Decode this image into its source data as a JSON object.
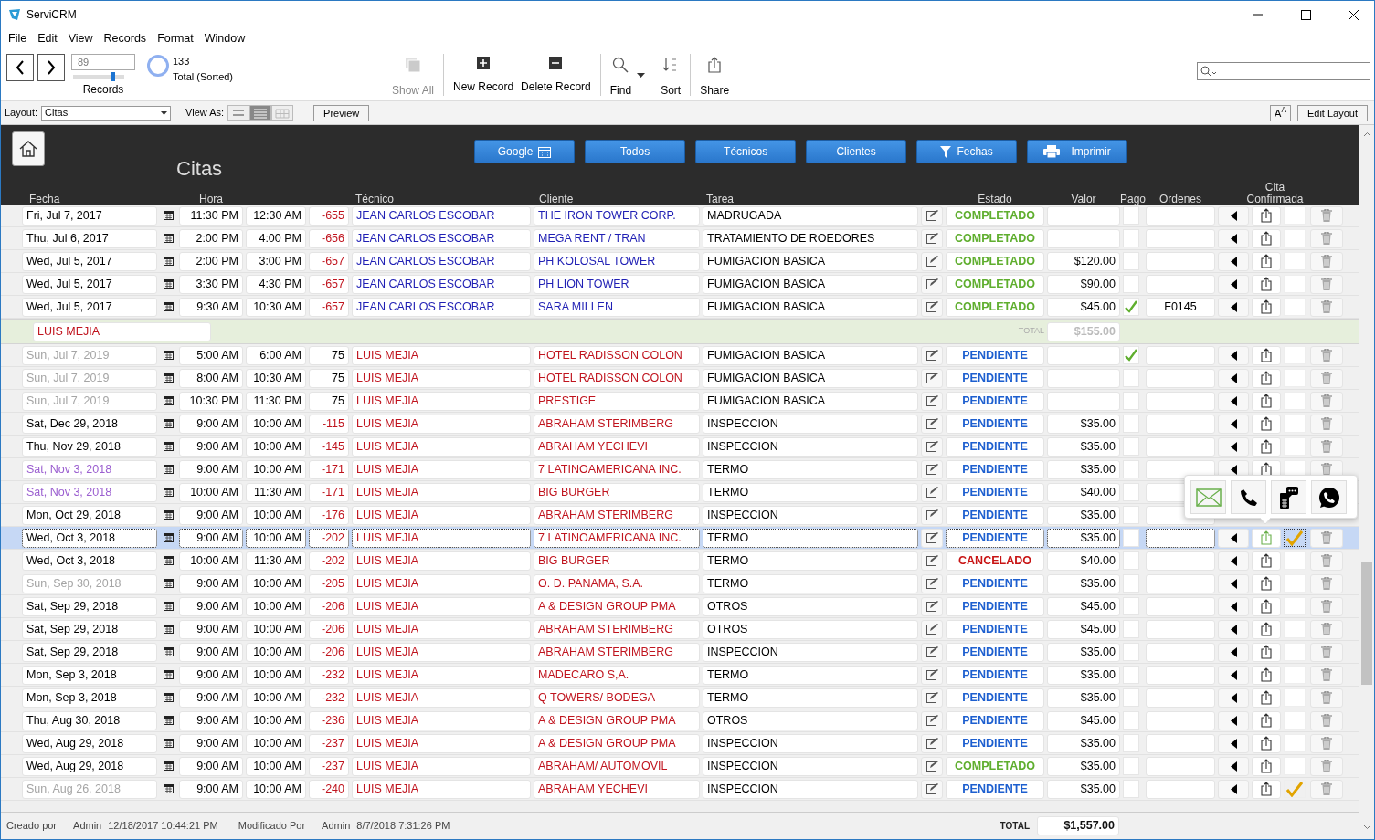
{
  "window": {
    "title": "ServiCRM"
  },
  "menu": [
    "File",
    "Edit",
    "View",
    "Records",
    "Format",
    "Window"
  ],
  "toolbar": {
    "record": "89",
    "slider": {
      "level": 0.78
    },
    "records_label": "Records",
    "total": "133",
    "total_label": "Total (Sorted)",
    "buttons": [
      {
        "label": "Show All",
        "kind": "show_all",
        "disabled": true
      },
      {
        "label": "New Record",
        "kind": "new",
        "disabled": false
      },
      {
        "label": "Delete Record",
        "kind": "delete",
        "disabled": false
      },
      {
        "label": "Find",
        "kind": "find",
        "disabled": false
      },
      {
        "label": "Sort",
        "kind": "sort",
        "disabled": false
      },
      {
        "label": "Share",
        "kind": "share",
        "disabled": false
      }
    ]
  },
  "layout_bar": {
    "layout_label": "Layout:",
    "layout": "Citas",
    "view_label": "View As:",
    "views": [
      {
        "kind": "form",
        "selected": false
      },
      {
        "kind": "list",
        "selected": true
      },
      {
        "kind": "table",
        "selected": false
      }
    ],
    "preview": "Preview",
    "font_button": "A$^{A}$",
    "edit_layout": "Edit Layout"
  },
  "header": {
    "title": "Citas",
    "buttons": [
      {
        "label": "Google"
      },
      {
        "label": "Todos"
      },
      {
        "label": "Técnicos"
      },
      {
        "label": "Clientes"
      },
      {
        "label": "Fechas"
      },
      {
        "label": "Imprimir"
      }
    ],
    "columns": [
      "Fecha",
      "Hora",
      "Técnico",
      "Cliente",
      "Tarea",
      "Estado",
      "Valor",
      "Pago",
      "Ordenes",
      "Cita Confirmada"
    ]
  },
  "rows": [
    {
      "kind": "record",
      "date": {
        "text": "Fri, Jul 7, 2017",
        "color": "#000000"
      },
      "start": "11:30 PM",
      "end": "12:30 AM",
      "number": "-655",
      "late": true,
      "technician": "JEAN CARLOS ESCOBAR",
      "client": "THE IRON TOWER CORP.",
      "color": "#1f1fb4",
      "task": "MADRUGADA",
      "status": {
        "text": "COMPLETADO",
        "color": "#5fae2e"
      },
      "value": "",
      "paid": false,
      "order": "",
      "confirmed": false,
      "selected": false
    },
    {
      "kind": "record",
      "date": {
        "text": "Thu, Jul 6, 2017",
        "color": "#000000"
      },
      "start": "2:00 PM",
      "end": "4:00 PM",
      "number": "-656",
      "late": true,
      "technician": "JEAN CARLOS ESCOBAR",
      "client": "MEGA RENT / TRAN",
      "color": "#1f1fb4",
      "task": "TRATAMIENTO DE ROEDORES",
      "status": {
        "text": "COMPLETADO",
        "color": "#5fae2e"
      },
      "value": "",
      "paid": false,
      "order": "",
      "confirmed": false,
      "selected": false
    },
    {
      "kind": "record",
      "date": {
        "text": "Wed, Jul 5, 2017",
        "color": "#000000"
      },
      "start": "2:00 PM",
      "end": "3:00 PM",
      "number": "-657",
      "late": true,
      "technician": "JEAN CARLOS ESCOBAR",
      "client": "PH KOLOSAL TOWER",
      "color": "#1f1fb4",
      "task": "FUMIGACION BASICA",
      "status": {
        "text": "COMPLETADO",
        "color": "#5fae2e"
      },
      "value": "$120.00",
      "paid": false,
      "order": "",
      "confirmed": false,
      "selected": false
    },
    {
      "kind": "record",
      "date": {
        "text": "Wed, Jul 5, 2017",
        "color": "#000000"
      },
      "start": "3:30 PM",
      "end": "4:30 PM",
      "number": "-657",
      "late": true,
      "technician": "JEAN CARLOS ESCOBAR",
      "client": "PH LION TOWER",
      "color": "#1f1fb4",
      "task": "FUMIGACION BASICA",
      "status": {
        "text": "COMPLETADO",
        "color": "#5fae2e"
      },
      "value": "$90.00",
      "paid": false,
      "order": "",
      "confirmed": false,
      "selected": false
    },
    {
      "kind": "record",
      "date": {
        "text": "Wed, Jul 5, 2017",
        "color": "#000000"
      },
      "start": "9:30 AM",
      "end": "10:30 AM",
      "number": "-657",
      "late": true,
      "technician": "JEAN CARLOS ESCOBAR",
      "client": "SARA MILLEN",
      "color": "#1f1fb4",
      "task": "FUMIGACION BASICA",
      "status": {
        "text": "COMPLETADO",
        "color": "#5fae2e"
      },
      "value": "$45.00",
      "paid": true,
      "order": "F0145",
      "confirmed": false,
      "selected": false
    },
    {
      "kind": "summary",
      "technician": "LUIS MEJIA",
      "total_label": "TOTAL",
      "total": "$155.00"
    },
    {
      "kind": "record",
      "date": {
        "text": "Sun, Jul 7, 2019",
        "color": "#a5a5a5"
      },
      "start": "5:00 AM",
      "end": "6:00 AM",
      "number": "75",
      "late": false,
      "technician": "LUIS MEJIA",
      "client": "HOTEL RADISSON COLON",
      "color": "#c0141e",
      "task": "FUMIGACION BASICA",
      "status": {
        "text": "PENDIENTE",
        "color": "#1d5fcf"
      },
      "value": "",
      "paid": true,
      "order": "",
      "confirmed": false,
      "selected": false
    },
    {
      "kind": "record",
      "date": {
        "text": "Sun, Jul 7, 2019",
        "color": "#a5a5a5"
      },
      "start": "8:00 AM",
      "end": "10:30 AM",
      "number": "75",
      "late": false,
      "technician": "LUIS MEJIA",
      "client": "HOTEL RADISSON COLON",
      "color": "#c0141e",
      "task": "FUMIGACION BASICA",
      "status": {
        "text": "PENDIENTE",
        "color": "#1d5fcf"
      },
      "value": "",
      "paid": false,
      "order": "",
      "confirmed": false,
      "selected": false
    },
    {
      "kind": "record",
      "date": {
        "text": "Sun, Jul 7, 2019",
        "color": "#a5a5a5"
      },
      "start": "10:30 PM",
      "end": "11:30 PM",
      "number": "75",
      "late": false,
      "technician": "LUIS MEJIA",
      "client": "PRESTIGE",
      "color": "#c0141e",
      "task": "FUMIGACION BASICA",
      "status": {
        "text": "PENDIENTE",
        "color": "#1d5fcf"
      },
      "value": "",
      "paid": false,
      "order": "",
      "confirmed": false,
      "selected": false
    },
    {
      "kind": "record",
      "date": {
        "text": "Sat, Dec 29, 2018",
        "color": "#000000"
      },
      "start": "9:00 AM",
      "end": "10:00 AM",
      "number": "-115",
      "late": true,
      "technician": "LUIS MEJIA",
      "client": "ABRAHAM STERIMBERG",
      "color": "#c0141e",
      "task": "INSPECCION",
      "status": {
        "text": "PENDIENTE",
        "color": "#1d5fcf"
      },
      "value": "$35.00",
      "paid": false,
      "order": "",
      "confirmed": false,
      "selected": false
    },
    {
      "kind": "record",
      "date": {
        "text": "Thu, Nov 29, 2018",
        "color": "#000000"
      },
      "start": "9:00 AM",
      "end": "10:00 AM",
      "number": "-145",
      "late": true,
      "technician": "LUIS MEJIA",
      "client": "ABRAHAM YECHEVI",
      "color": "#c0141e",
      "task": "INSPECCION",
      "status": {
        "text": "PENDIENTE",
        "color": "#1d5fcf"
      },
      "value": "$35.00",
      "paid": false,
      "order": "",
      "confirmed": false,
      "selected": false
    },
    {
      "kind": "record",
      "date": {
        "text": "Sat, Nov 3, 2018",
        "color": "#9b5fd0"
      },
      "start": "9:00 AM",
      "end": "10:00 AM",
      "number": "-171",
      "late": true,
      "technician": "LUIS MEJIA",
      "client": "7 LATINOAMERICANA  INC.",
      "color": "#c0141e",
      "task": "TERMO",
      "status": {
        "text": "PENDIENTE",
        "color": "#1d5fcf"
      },
      "value": "$35.00",
      "paid": false,
      "order": "",
      "confirmed": false,
      "selected": false
    },
    {
      "kind": "record",
      "date": {
        "text": "Sat, Nov 3, 2018",
        "color": "#9b5fd0"
      },
      "start": "10:00 AM",
      "end": "11:30 AM",
      "number": "-171",
      "late": true,
      "technician": "LUIS MEJIA",
      "client": "BIG BURGER",
      "color": "#c0141e",
      "task": "TERMO",
      "status": {
        "text": "PENDIENTE",
        "color": "#1d5fcf"
      },
      "value": "$40.00",
      "paid": false,
      "order": "",
      "selected": false
    },
    {
      "kind": "record",
      "date": {
        "text": "Mon, Oct 29, 2018",
        "color": "#000000"
      },
      "start": "9:00 AM",
      "end": "10:00 AM",
      "number": "-176",
      "late": true,
      "technician": "LUIS MEJIA",
      "client": "ABRAHAM STERIMBERG",
      "color": "#c0141e",
      "task": "INSPECCION",
      "status": {
        "text": "PENDIENTE",
        "color": "#1d5fcf"
      },
      "value": "$35.00",
      "paid": false,
      "order": "",
      "selected": false
    },
    {
      "kind": "record",
      "date": {
        "text": "Wed, Oct 3, 2018",
        "color": "#000000"
      },
      "start": "9:00 AM",
      "end": "10:00 AM",
      "number": "-202",
      "late": true,
      "technician": "LUIS MEJIA",
      "client": "7 LATINOAMERICANA  INC.",
      "color": "#c0141e",
      "task": "TERMO",
      "status": {
        "text": "PENDIENTE",
        "color": "#1d5fcf"
      },
      "value": "$35.00",
      "paid": false,
      "order": "",
      "confirmed": true,
      "selected": true
    },
    {
      "kind": "record",
      "date": {
        "text": "Wed, Oct 3, 2018",
        "color": "#000000"
      },
      "start": "10:00 AM",
      "end": "11:30 AM",
      "number": "-202",
      "late": true,
      "technician": "LUIS MEJIA",
      "client": "BIG BURGER",
      "color": "#c0141e",
      "task": "TERMO",
      "status": {
        "text": "CANCELADO",
        "color": "#c81414"
      },
      "value": "$40.00",
      "paid": false,
      "order": "",
      "confirmed": false,
      "selected": false
    },
    {
      "kind": "record",
      "date": {
        "text": "Sun, Sep 30, 2018",
        "color": "#a5a5a5"
      },
      "start": "9:00 AM",
      "end": "10:00 AM",
      "number": "-205",
      "late": true,
      "technician": "LUIS MEJIA",
      "client": "O. D. PANAMA, S.A.",
      "color": "#c0141e",
      "task": "TERMO",
      "status": {
        "text": "PENDIENTE",
        "color": "#1d5fcf"
      },
      "value": "$35.00",
      "paid": false,
      "order": "",
      "confirmed": false,
      "selected": false
    },
    {
      "kind": "record",
      "date": {
        "text": "Sat, Sep 29, 2018",
        "color": "#000000"
      },
      "start": "9:00 AM",
      "end": "10:00 AM",
      "number": "-206",
      "late": true,
      "technician": "LUIS MEJIA",
      "client": "A & DESIGN GROUP PMA",
      "color": "#c0141e",
      "task": "OTROS",
      "status": {
        "text": "PENDIENTE",
        "color": "#1d5fcf"
      },
      "value": "$45.00",
      "paid": false,
      "order": "",
      "confirmed": false,
      "selected": false
    },
    {
      "kind": "record",
      "date": {
        "text": "Sat, Sep 29, 2018",
        "color": "#000000"
      },
      "start": "9:00 AM",
      "end": "10:00 AM",
      "number": "-206",
      "late": true,
      "technician": "LUIS MEJIA",
      "client": "ABRAHAM STERIMBERG",
      "color": "#c0141e",
      "task": "OTROS",
      "status": {
        "text": "PENDIENTE",
        "color": "#1d5fcf"
      },
      "value": "$45.00",
      "paid": false,
      "order": "",
      "confirmed": false,
      "selected": false
    },
    {
      "kind": "record",
      "date": {
        "text": "Sat, Sep 29, 2018",
        "color": "#000000"
      },
      "start": "9:00 AM",
      "end": "10:00 AM",
      "number": "-206",
      "late": true,
      "technician": "LUIS MEJIA",
      "client": "ABRAHAM STERIMBERG",
      "color": "#c0141e",
      "task": "INSPECCION",
      "status": {
        "text": "PENDIENTE",
        "color": "#1d5fcf"
      },
      "value": "$35.00",
      "paid": false,
      "order": "",
      "confirmed": false,
      "selected": false
    },
    {
      "kind": "record",
      "date": {
        "text": "Mon, Sep 3, 2018",
        "color": "#000000"
      },
      "start": "9:00 AM",
      "end": "10:00 AM",
      "number": "-232",
      "late": true,
      "technician": "LUIS MEJIA",
      "client": "MADECARO S,A.",
      "color": "#c0141e",
      "task": "TERMO",
      "status": {
        "text": "PENDIENTE",
        "color": "#1d5fcf"
      },
      "value": "$35.00",
      "paid": false,
      "order": "",
      "confirmed": false,
      "selected": false
    },
    {
      "kind": "record",
      "date": {
        "text": "Mon, Sep 3, 2018",
        "color": "#000000"
      },
      "start": "9:00 AM",
      "end": "10:00 AM",
      "number": "-232",
      "late": true,
      "technician": "LUIS MEJIA",
      "client": "Q TOWERS/ BODEGA",
      "color": "#c0141e",
      "task": "TERMO",
      "status": {
        "text": "PENDIENTE",
        "color": "#1d5fcf"
      },
      "value": "$35.00",
      "paid": false,
      "order": "",
      "confirmed": false,
      "selected": false
    },
    {
      "kind": "record",
      "date": {
        "text": "Thu, Aug 30, 2018",
        "color": "#000000"
      },
      "start": "9:00 AM",
      "end": "10:00 AM",
      "number": "-236",
      "late": true,
      "technician": "LUIS MEJIA",
      "client": "A & DESIGN GROUP PMA",
      "color": "#c0141e",
      "task": "OTROS",
      "status": {
        "text": "PENDIENTE",
        "color": "#1d5fcf"
      },
      "value": "$45.00",
      "paid": false,
      "order": "",
      "confirmed": false,
      "selected": false
    },
    {
      "kind": "record",
      "date": {
        "text": "Wed, Aug 29, 2018",
        "color": "#000000"
      },
      "start": "9:00 AM",
      "end": "10:00 AM",
      "number": "-237",
      "late": true,
      "technician": "LUIS MEJIA",
      "client": "A & DESIGN GROUP PMA",
      "color": "#c0141e",
      "task": "INSPECCION",
      "status": {
        "text": "PENDIENTE",
        "color": "#1d5fcf"
      },
      "value": "$35.00",
      "paid": false,
      "order": "",
      "confirmed": false,
      "selected": false
    },
    {
      "kind": "record",
      "date": {
        "text": "Wed, Aug 29, 2018",
        "color": "#000000"
      },
      "start": "9:00 AM",
      "end": "10:00 AM",
      "number": "-237",
      "late": true,
      "technician": "LUIS MEJIA",
      "client": "ABRAHAM/ AUTOMOVIL",
      "color": "#c0141e",
      "task": "INSPECCION",
      "status": {
        "text": "COMPLETADO",
        "color": "#5fae2e"
      },
      "value": "$35.00",
      "paid": false,
      "order": "",
      "confirmed": false,
      "selected": false
    },
    {
      "kind": "record",
      "date": {
        "text": "Sun, Aug 26, 2018",
        "color": "#a5a5a5"
      },
      "start": "9:00 AM",
      "end": "10:00 AM",
      "number": "-240",
      "late": true,
      "technician": "LUIS MEJIA",
      "client": "ABRAHAM YECHEVI",
      "color": "#c0141e",
      "task": "INSPECCION",
      "status": {
        "text": "PENDIENTE",
        "color": "#1d5fcf"
      },
      "value": "$35.00",
      "paid": false,
      "order": "",
      "confirmed": true,
      "selected": false
    }
  ],
  "footer": {
    "created_label": "Creado por",
    "created_by": "Admin",
    "created_at": "12/18/2017 10:44:21 PM",
    "modified_label": "Modificado Por",
    "modified_by": "Admin",
    "modified_at": "8/7/2018 7:31:26 PM",
    "total_label": "TOTAL",
    "total": "$1,557.00"
  }
}
